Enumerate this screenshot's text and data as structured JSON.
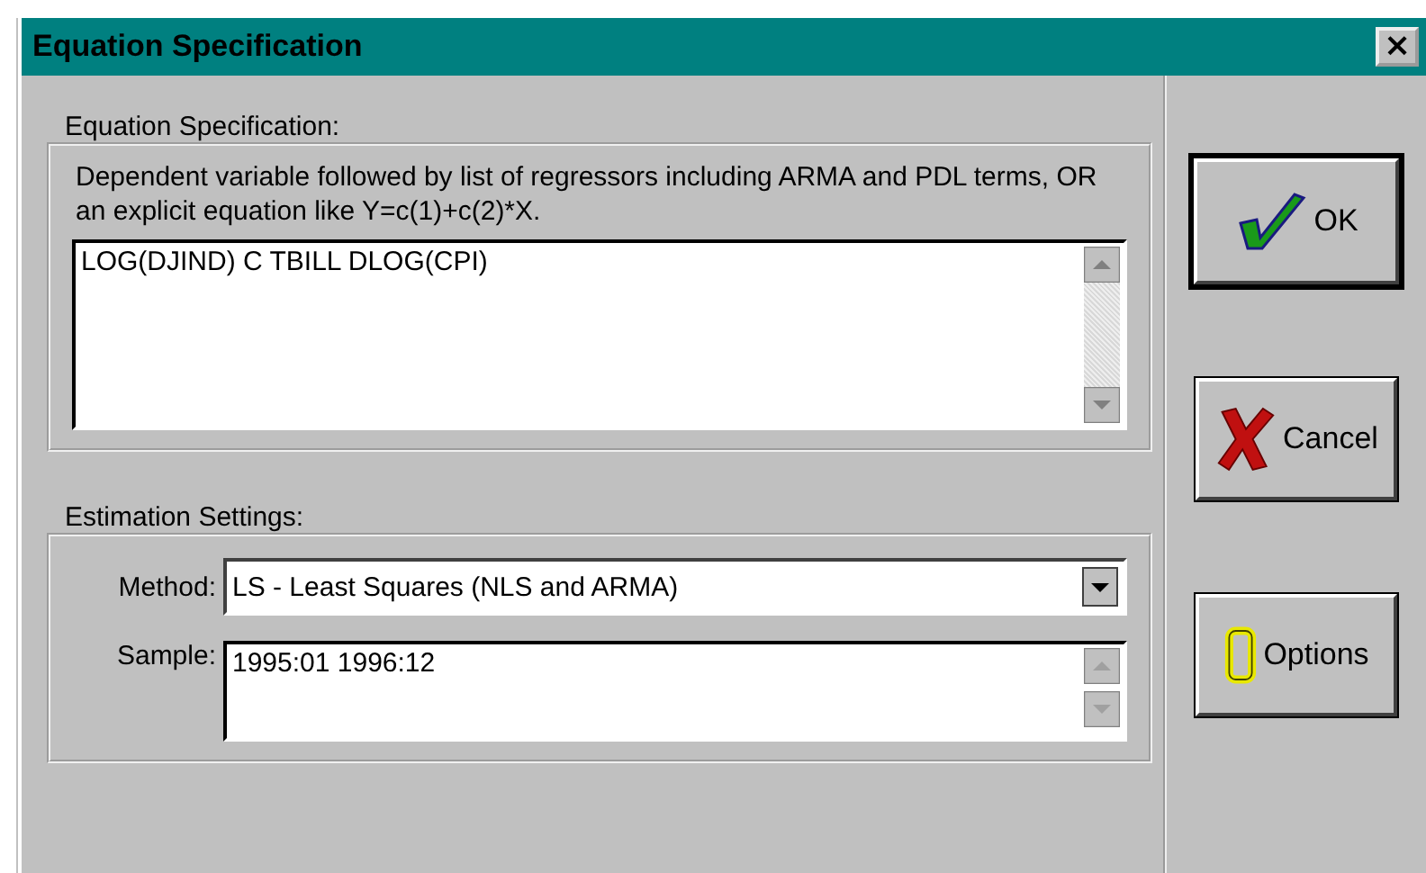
{
  "window": {
    "title": "Equation Specification",
    "close": "×"
  },
  "equation_group": {
    "label": "Equation Specification:",
    "hint": "Dependent variable followed by list of regressors including ARMA and PDL terms, OR an explicit equation like Y=c(1)+c(2)*X.",
    "value": "LOG(DJIND) C TBILL DLOG(CPI)"
  },
  "settings_group": {
    "label": "Estimation Settings:",
    "method_label": "Method:",
    "method_value": "LS  -  Least Squares (NLS and ARMA)",
    "sample_label": "Sample:",
    "sample_value": "1995:01 1996:12"
  },
  "buttons": [
    {
      "kind": "check",
      "label": "OK",
      "default": true
    },
    {
      "kind": "cross",
      "label": "Cancel",
      "default": false
    },
    {
      "kind": "letter",
      "label": "Options",
      "default": false
    }
  ]
}
